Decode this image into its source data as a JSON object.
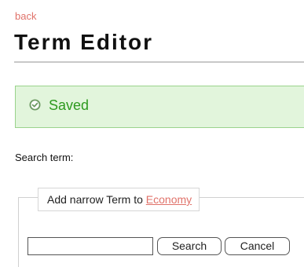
{
  "nav": {
    "back_label": "back"
  },
  "header": {
    "title": "Term Editor"
  },
  "status": {
    "message": "Saved",
    "icon": "check-circle-icon",
    "colors": {
      "background": "#e2f5dc",
      "border": "#9ad38c",
      "text": "#2e9a1f"
    }
  },
  "search": {
    "label": "Search term:"
  },
  "narrow_term": {
    "legend_prefix": "Add narrow Term to",
    "parent_term": "Economy",
    "input_value": "",
    "search_label": "Search",
    "cancel_label": "Cancel"
  },
  "colors": {
    "link": "#e0726a"
  }
}
